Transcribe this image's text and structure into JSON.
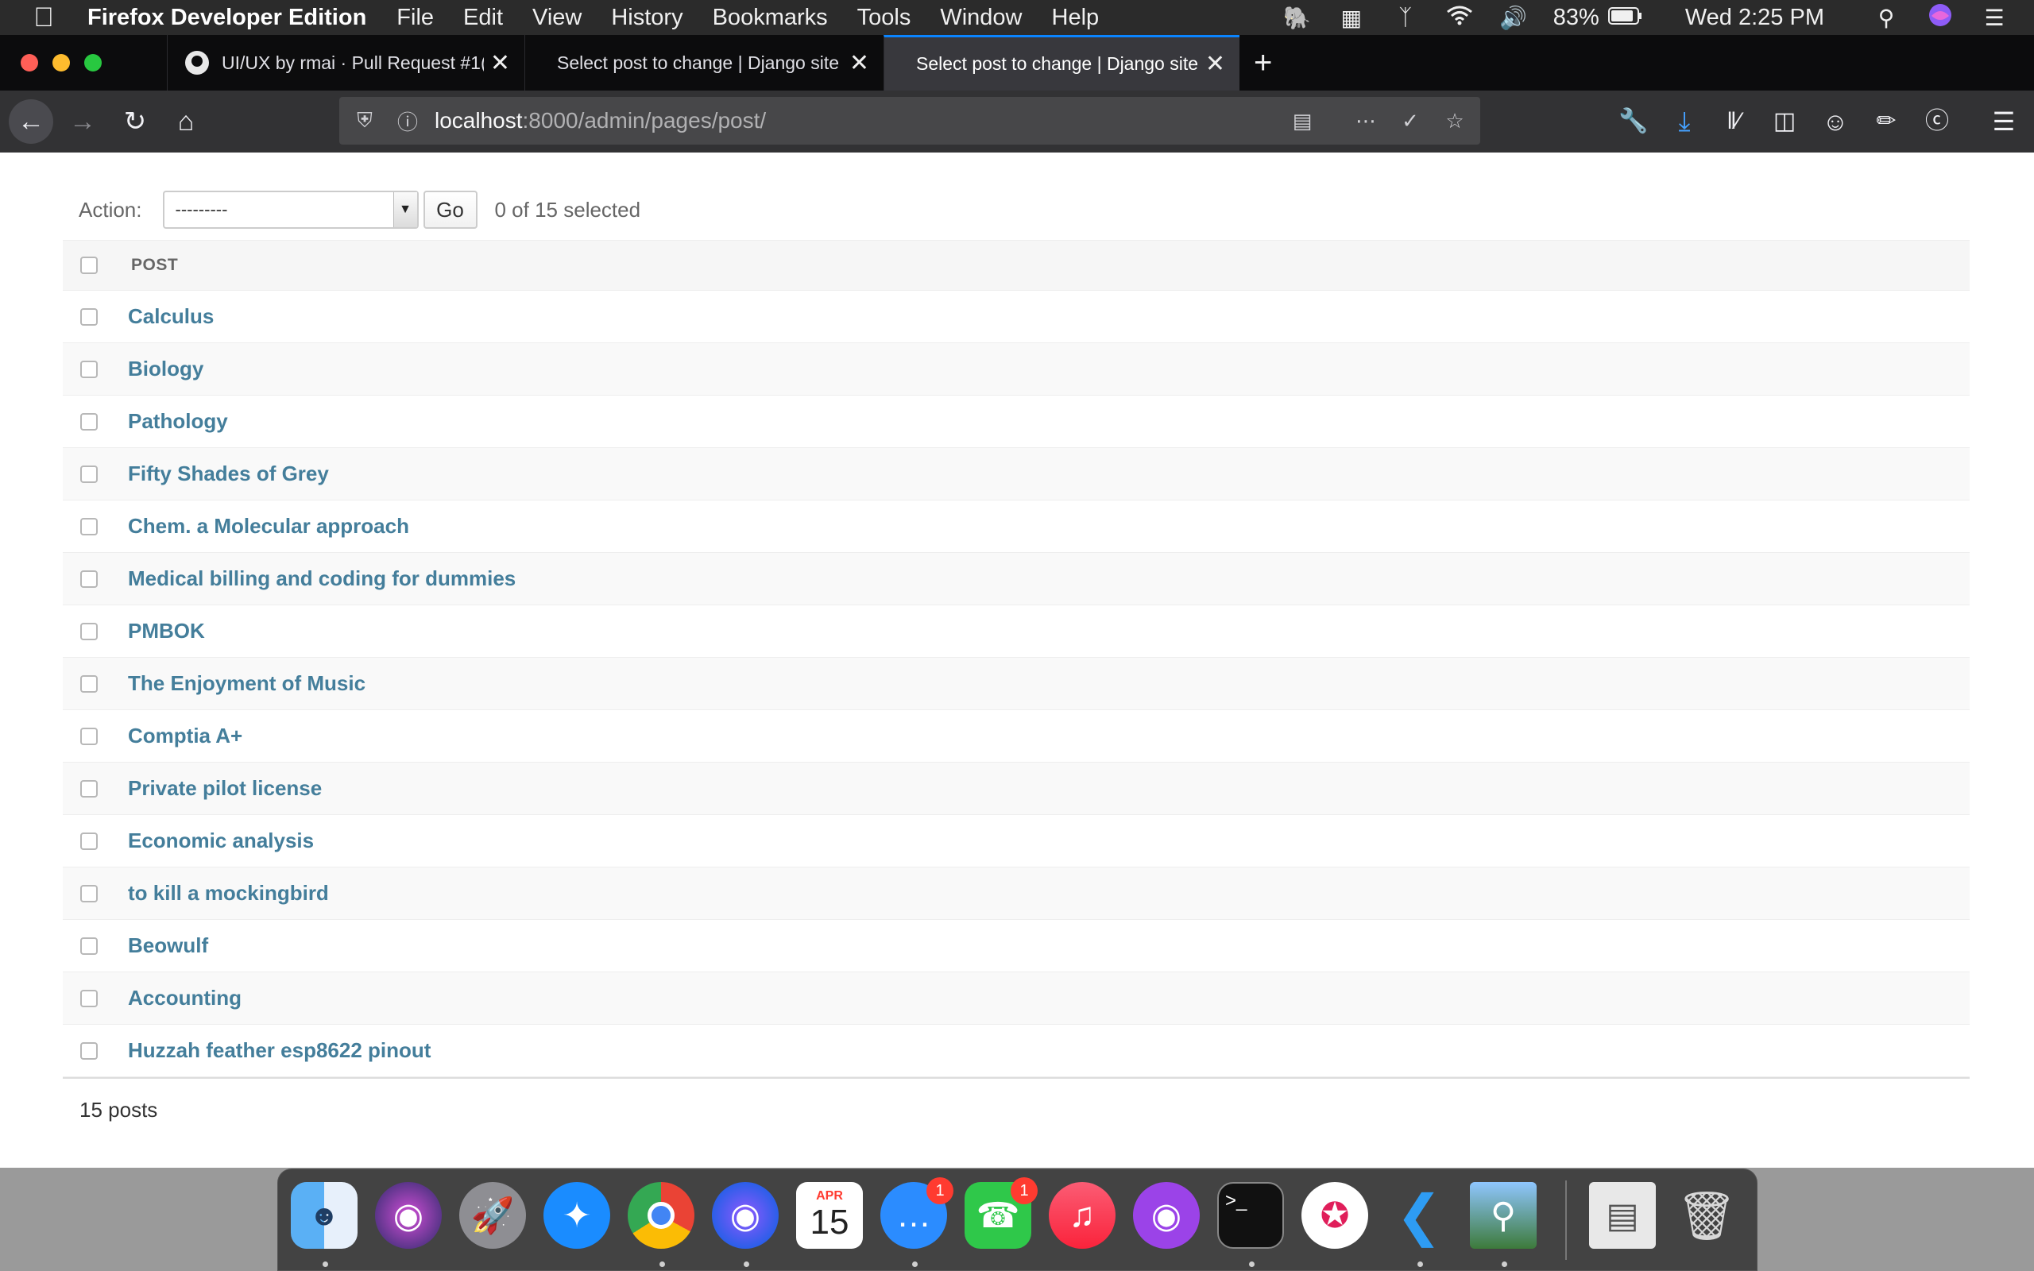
{
  "menubar": {
    "app_name": "Firefox Developer Edition",
    "items": [
      "File",
      "Edit",
      "View",
      "History",
      "Bookmarks",
      "Tools",
      "Window",
      "Help"
    ],
    "battery": "83%",
    "clock": "Wed 2:25 PM",
    "status_icons": [
      "evernote-icon",
      "windows-icon",
      "bluetooth-icon",
      "wifi-icon",
      "volume-icon",
      "battery-icon"
    ]
  },
  "tabs": [
    {
      "label": "UI/UX by rmai · Pull Request #1(",
      "icon": "github-icon",
      "active": false
    },
    {
      "label": "Select post to change | Django site",
      "icon": "",
      "active": false
    },
    {
      "label": "Select post to change | Django site",
      "icon": "",
      "active": true
    }
  ],
  "tab_close_glyph": "✕",
  "new_tab_glyph": "+",
  "urlbar": {
    "host": "localhost",
    "path": ":8000/admin/pages/post/"
  },
  "actions": {
    "label": "Action:",
    "select_value": "---------",
    "go_label": "Go",
    "counter": "0 of 15 selected"
  },
  "table": {
    "header": "POST",
    "rows": [
      "Calculus",
      "Biology",
      "Pathology",
      "Fifty Shades of Grey",
      "Chem. a Molecular approach",
      "Medical billing and coding for dummies",
      "PMBOK",
      "The Enjoyment of Music",
      "Comptia A+",
      "Private pilot license",
      "Economic analysis",
      "to kill a mockingbird",
      "Beowulf",
      "Accounting",
      "Huzzah feather esp8622 pinout"
    ]
  },
  "paginator": "15 posts",
  "dock": {
    "calendar_month": "APR",
    "calendar_day": "15",
    "messages_badge": "1",
    "facetime_badge": "1",
    "terminal_prompt": ">_"
  },
  "colors": {
    "link": "#447e9b",
    "active_tab_accent": "#0a84ff"
  }
}
